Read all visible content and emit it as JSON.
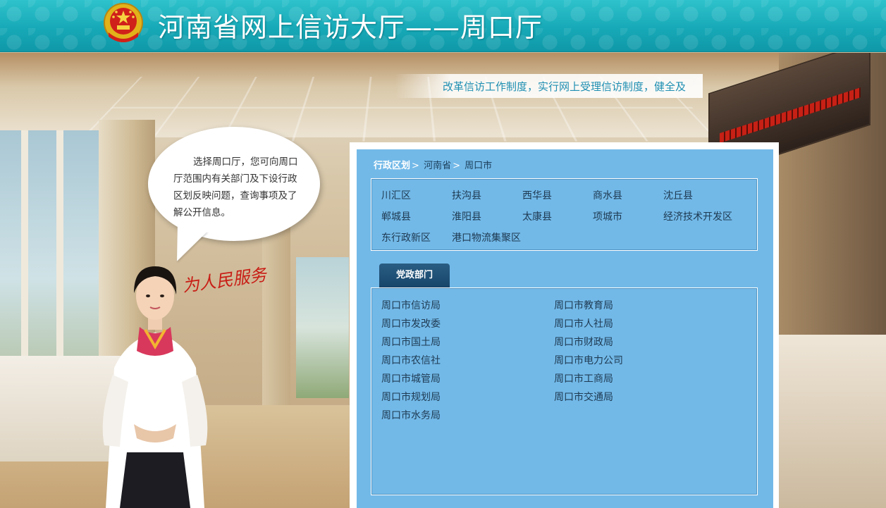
{
  "header": {
    "title": "河南省网上信访大厅——周口厅",
    "emblem_icon": "national-emblem-icon"
  },
  "slogan": {
    "text": "改革信访工作制度，实行网上受理信访制度，健全及"
  },
  "bubble": {
    "text": "选择周口厅，您可向周口厅范围内有关部门及下设行政区划反映问题，查询事项及了解公开信息。"
  },
  "calligraphy": "为人民服务",
  "breadcrumb": {
    "root": "行政区划",
    "sep": ">",
    "level1": "河南省",
    "level2": "周口市"
  },
  "regions": [
    "川汇区",
    "扶沟县",
    "西华县",
    "商水县",
    "沈丘县",
    "郸城县",
    "淮阳县",
    "太康县",
    "项城市",
    "经济技术开发区",
    "东行政新区",
    "港口物流集聚区"
  ],
  "tab": {
    "label": "党政部门"
  },
  "departments": {
    "left": [
      "周口市信访局",
      "周口市发改委",
      "周口市国土局",
      "周口市农信社",
      "周口市城管局",
      "周口市规划局",
      "周口市水务局"
    ],
    "right": [
      "周口市教育局",
      "周口市人社局",
      "周口市财政局",
      "周口市电力公司",
      "周口市工商局",
      "周口市交通局"
    ]
  },
  "colors": {
    "header": "#17a9b7",
    "panel": "#72b9e8",
    "tab": "#17456a",
    "slogan": "#1f8fb2",
    "calligraphy": "#c81d15"
  }
}
